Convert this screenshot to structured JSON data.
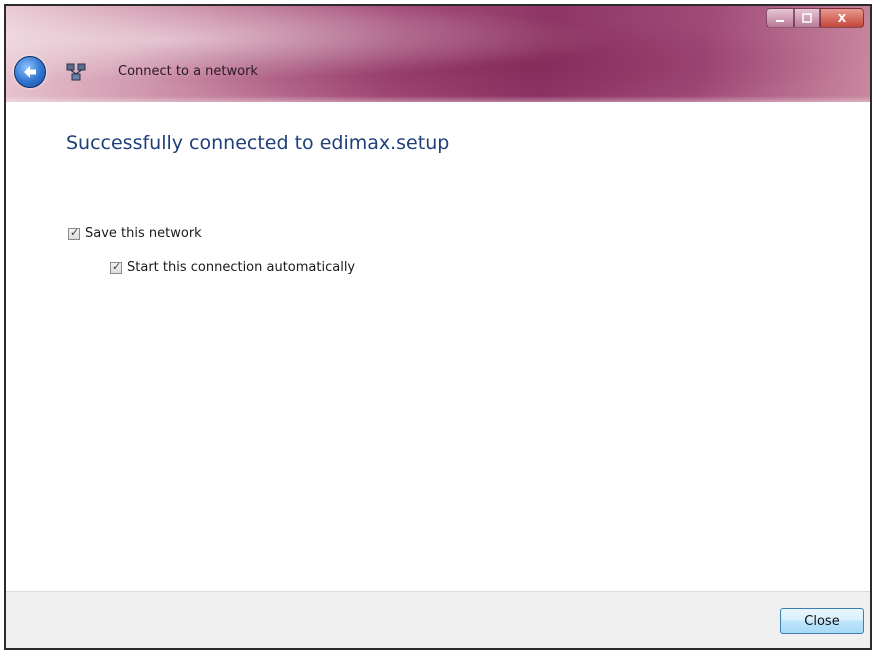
{
  "window": {
    "title": "Connect to a network",
    "caption_buttons": {
      "minimize_icon": "minimize-icon",
      "maximize_icon": "maximize-icon",
      "close_icon": "close-icon",
      "close_label": "X"
    },
    "back_icon": "back-arrow-icon",
    "network_icon": "network-icon"
  },
  "main": {
    "heading": "Successfully connected to edimax.setup",
    "checkboxes": [
      {
        "label": "Save this network",
        "checked": true
      },
      {
        "label": "Start this connection automatically",
        "checked": true
      }
    ]
  },
  "footer": {
    "close_button": "Close"
  },
  "colors": {
    "heading": "#1f3f7a",
    "titlebar": "#a24b77",
    "footer_bg": "#f0f0f0"
  }
}
